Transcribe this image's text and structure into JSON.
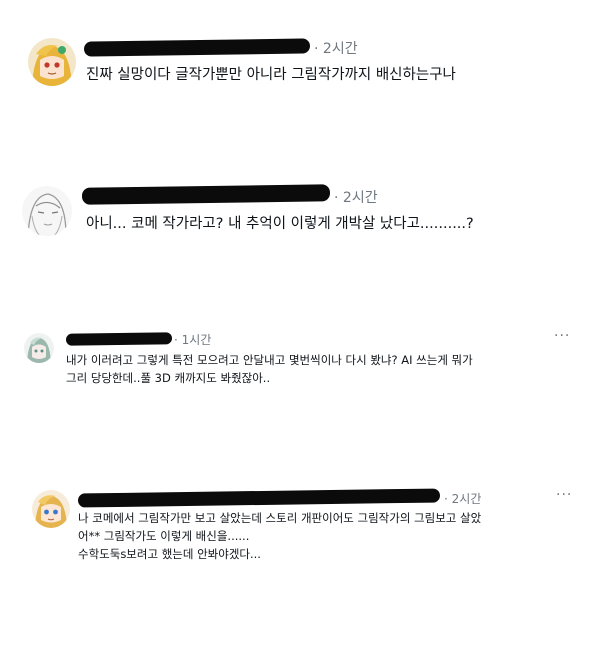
{
  "posts": [
    {
      "time": "2시간",
      "lines": [
        "진짜 실망이다 글작가뿐만 아니라 그림작가까지 배신하는구나"
      ],
      "has_more": false
    },
    {
      "time": "2시간",
      "lines": [
        "아니... 코메 작가라고? 내 추억이 이렇게 개박살 났다고..........?"
      ],
      "has_more": false
    },
    {
      "time": "1시간",
      "lines": [
        "내가 이러려고 그렇게 특전 모으려고 안달내고 몇번씩이나 다시 봤냐? AI 쓰는게 뭐가",
        "그리 당당한데..풀 3D 캐까지도 봐줬잖아.."
      ],
      "has_more": true,
      "more_label": "···"
    },
    {
      "time": "2시간",
      "lines": [
        "나 코메에서 그림작가만 보고 살았는데 스토리 개판이어도 그림작가의 그림보고 살았",
        "어** 그림작가도 이렇게 배신을......",
        "수학도둑s보려고 했는데 안봐야겠다..."
      ],
      "has_more": true,
      "more_label": "···"
    }
  ]
}
